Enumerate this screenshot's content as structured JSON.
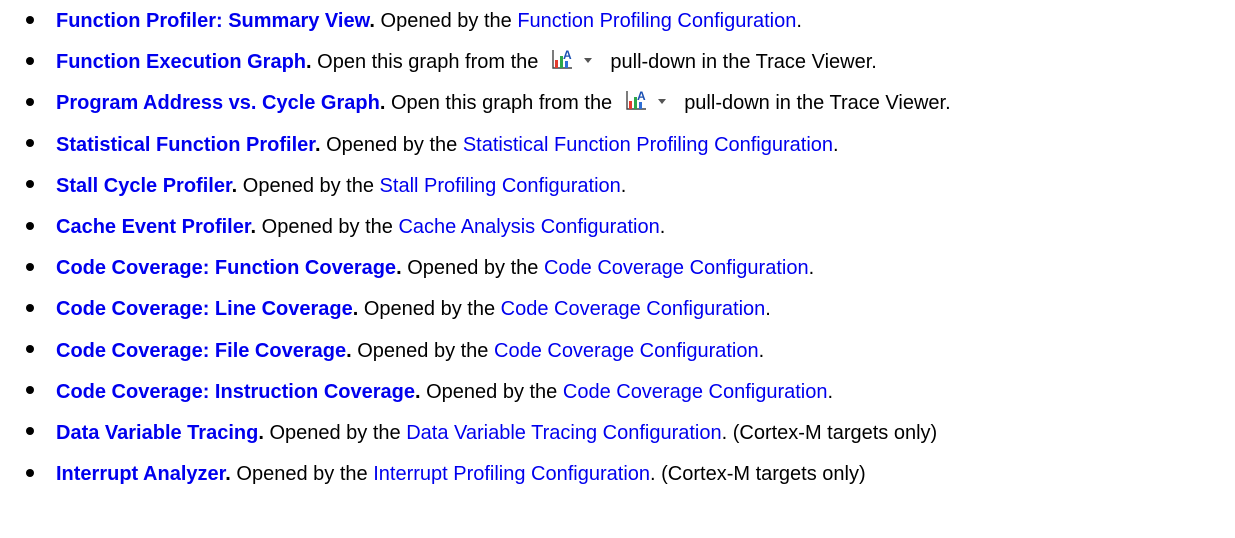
{
  "items": [
    {
      "title": "Function Profiler: Summary View",
      "pre": "Opened by the ",
      "link": "Function Profiling Configuration",
      "post": "."
    },
    {
      "title": "Function Execution Graph",
      "pre": "Open this graph from the",
      "post": "pull-down in the Trace Viewer.",
      "icon": "graph-toolbar-icon"
    },
    {
      "title": "Program Address vs. Cycle Graph",
      "pre": "Open this graph from the",
      "post": "pull-down in the Trace Viewer.",
      "icon": "graph-toolbar-icon"
    },
    {
      "title": "Statistical Function Profiler",
      "pre": "Opened by the ",
      "link": "Statistical Function Profiling Configuration",
      "post": "."
    },
    {
      "title": "Stall Cycle Profiler",
      "pre": "Opened by the ",
      "link": "Stall Profiling Configuration",
      "post": "."
    },
    {
      "title": "Cache Event Profiler",
      "pre": "Opened by the ",
      "link": "Cache Analysis Configuration",
      "post": "."
    },
    {
      "title": "Code Coverage: Function Coverage",
      "pre": "Opened by the ",
      "link": "Code Coverage Configuration",
      "post": "."
    },
    {
      "title": "Code Coverage: Line Coverage",
      "pre": "Opened by the ",
      "link": "Code Coverage Configuration",
      "post": "."
    },
    {
      "title": "Code Coverage: File Coverage",
      "pre": "Opened by the ",
      "link": "Code Coverage Configuration",
      "post": "."
    },
    {
      "title": "Code Coverage: Instruction Coverage",
      "pre": "Opened by the ",
      "link": "Code Coverage Configuration",
      "post": "."
    },
    {
      "title": "Data Variable Tracing",
      "pre": "Opened by the ",
      "link": "Data Variable Tracing Configuration",
      "post": ". (Cortex-M targets only)"
    },
    {
      "title": "Interrupt Analyzer",
      "pre": "Opened by the ",
      "link": "Interrupt Profiling Configuration",
      "post": ". (Cortex-M targets only)"
    }
  ],
  "colors": {
    "link": "#0000ee",
    "text": "#000000",
    "icon_red": "#e23b2e",
    "icon_green": "#2da84a",
    "icon_blue": "#2f6fd6"
  }
}
